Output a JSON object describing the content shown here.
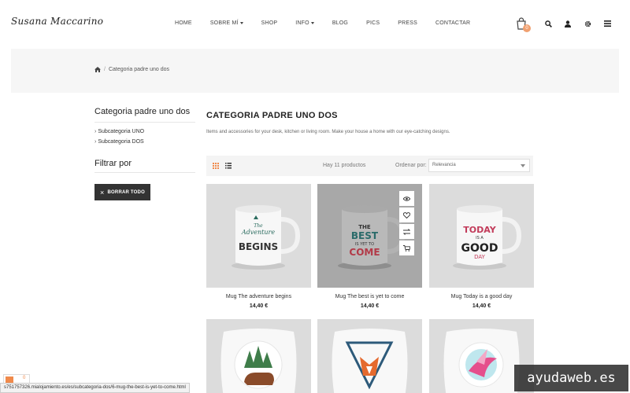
{
  "header": {
    "logo": "Susana Maccarino",
    "nav": [
      {
        "label": "HOME",
        "dropdown": false
      },
      {
        "label": "SOBRE MÍ",
        "dropdown": true
      },
      {
        "label": "SHOP",
        "dropdown": false
      },
      {
        "label": "INFO",
        "dropdown": true
      },
      {
        "label": "BLOG",
        "dropdown": false
      },
      {
        "label": "PICS",
        "dropdown": false
      },
      {
        "label": "PRESS",
        "dropdown": false
      },
      {
        "label": "CONTACTAR",
        "dropdown": false
      }
    ],
    "cart_count": "0",
    "icons": [
      "cart-icon",
      "search-icon",
      "user-icon",
      "gear-icon",
      "menu-icon"
    ]
  },
  "breadcrumb": {
    "home_icon": "home-icon",
    "current": "Categoria padre uno dos"
  },
  "sidebar": {
    "category_title": "Categoria padre uno dos",
    "subcategories": [
      "Subcategoria UNO",
      "Subcategoria DOS"
    ],
    "filter_title": "Filtrar por",
    "clear_all_label": "BORRAR TODO"
  },
  "main": {
    "title": "CATEGORIA PADRE UNO DOS",
    "description": "Items and accessories for your desk, kitchen or living room. Make your house a home with our eye-catching designs.",
    "product_count": "Hay 11 productos",
    "order_label": "Ordenar por:",
    "order_value": "Relevancia"
  },
  "products": [
    {
      "name": "Mug The adventure begins",
      "price": "14,40 €",
      "art": [
        "The",
        "Adventure",
        "BEGINS"
      ]
    },
    {
      "name": "Mug The best is yet to come",
      "price": "14,40 €",
      "art": [
        "THE",
        "BEST",
        "IS YET TO",
        "COME"
      ]
    },
    {
      "name": "Mug Today is a good day",
      "price": "14,40 €",
      "art": [
        "TODAY",
        "IS A",
        "GOOD",
        "DAY"
      ]
    }
  ],
  "status_url": "s751757326.mialojamiento.es/es/subcategoria-dos/6-mug-the-best-is-yet-to-come.html",
  "fb_count": "0",
  "watermark": "ayudaweb.es",
  "colors": {
    "accent": "#f0a070",
    "grid_active": "#f08a4b",
    "button_dark": "#333333"
  }
}
